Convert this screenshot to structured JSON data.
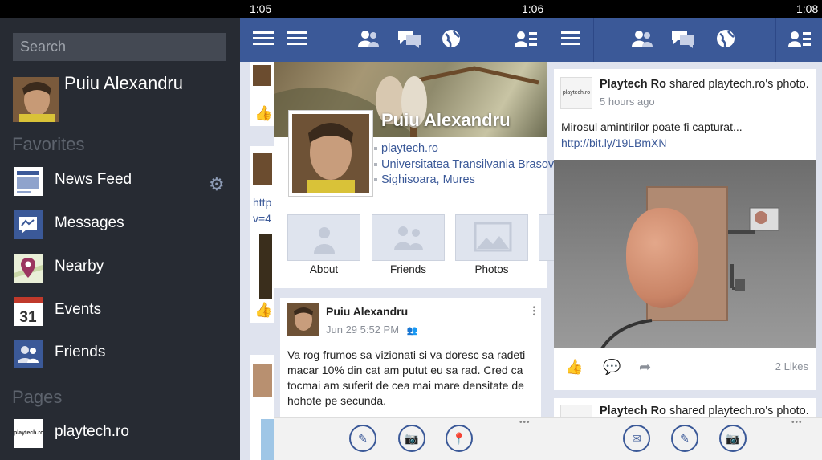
{
  "status": {
    "time1": "1:05",
    "time2": "1:06",
    "time3": "1:08"
  },
  "menu": {
    "search_placeholder": "Search",
    "user_name": "Puiu Alexandru",
    "favorites_header": "Favorites",
    "items": [
      {
        "label": "News Feed",
        "icon": "news-feed-icon"
      },
      {
        "label": "Messages",
        "icon": "messages-icon"
      },
      {
        "label": "Nearby",
        "icon": "nearby-icon"
      },
      {
        "label": "Events",
        "icon": "events-icon",
        "badge": "31"
      },
      {
        "label": "Friends",
        "icon": "friends-icon"
      }
    ],
    "pages_header": "Pages",
    "pages": [
      {
        "label": "playtech.ro",
        "logo": "playtech.ro"
      }
    ]
  },
  "profile": {
    "name": "Puiu Alexandru",
    "info": [
      "playtech.ro",
      "Universitatea Transilvania Brasov",
      "Sighisoara, Mures"
    ],
    "tiles": [
      "About",
      "Friends",
      "Photos"
    ]
  },
  "post": {
    "author": "Puiu Alexandru",
    "time": "Jun 29 5:52 PM",
    "text": "Va rog frumos sa vizionati si va doresc sa radeti macar 10% din cat am putut eu sa rad. Cred ca tocmai am suferit de cea mai mare densitate de hohote pe secunda."
  },
  "left_strip": {
    "link1": "http",
    "link2": "v=4"
  },
  "feed": {
    "story_author": "Playtech Ro",
    "story_verb": " shared playtech.ro's photo.",
    "time": "5 hours ago",
    "text": "Mirosul amintirilor poate fi capturat... ",
    "link": "http://bit.ly/19LBmXN",
    "likes": "2 Likes",
    "next_author": "Playtech Ro",
    "next_verb": " shared playtech.ro's photo."
  },
  "ellipsis": "•••",
  "colors": {
    "brand": "#3b5998",
    "menu_bg": "#272b33",
    "feed_bg": "#dfe3ee"
  }
}
